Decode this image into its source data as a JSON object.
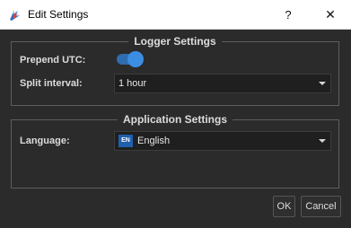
{
  "window": {
    "title": "Edit Settings",
    "icon": "app-logo-icon",
    "help_label": "?",
    "close_label": "✕"
  },
  "logger_settings": {
    "title": "Logger Settings",
    "prepend_utc_label": "Prepend UTC:",
    "prepend_utc_enabled": true,
    "split_interval_label": "Split interval:",
    "split_interval_value": "1 hour"
  },
  "application_settings": {
    "title": "Application Settings",
    "language_label": "Language:",
    "language_flag": "EN",
    "language_value": "English"
  },
  "buttons": {
    "ok": "OK",
    "cancel": "Cancel"
  },
  "colors": {
    "background": "#2b2b2b",
    "accent": "#3c8ee2",
    "titlebar": "#ffffff"
  }
}
